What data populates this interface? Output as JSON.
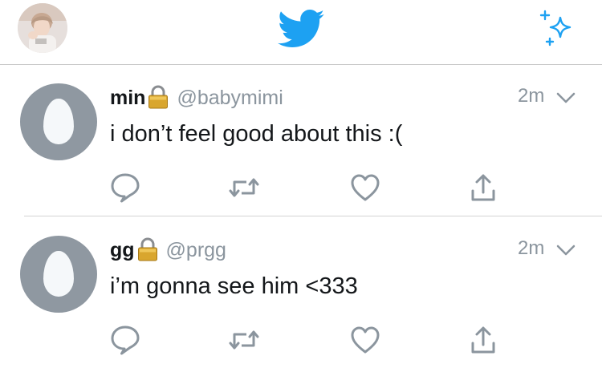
{
  "header": {
    "avatar_icon": "profile-photo",
    "logo_icon": "twitter-bird-icon",
    "compose_icon": "sparkle-icon",
    "accent_color": "#1da1f2"
  },
  "tweets": [
    {
      "display_name": "min",
      "protected_icon": "lock-icon",
      "handle": "@babymimi",
      "time": "2m",
      "text": "i don’t feel good about this :(",
      "actions": [
        "reply-icon",
        "retweet-icon",
        "like-icon",
        "share-icon"
      ]
    },
    {
      "display_name": "gg",
      "protected_icon": "lock-icon",
      "handle": "@prgg",
      "time": "2m",
      "text": "i’m gonna see him <333",
      "actions": [
        "reply-icon",
        "retweet-icon",
        "like-icon",
        "share-icon"
      ]
    }
  ]
}
